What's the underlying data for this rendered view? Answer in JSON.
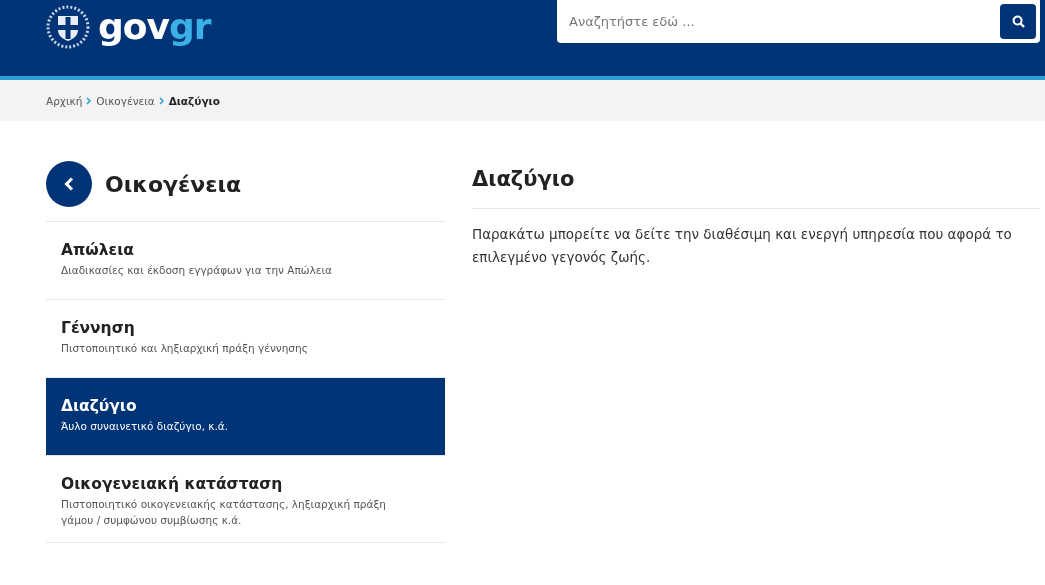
{
  "header": {
    "logo": {
      "main": "gov",
      "accent": "gr"
    },
    "search": {
      "placeholder": "Αναζητήστε εδώ ..."
    }
  },
  "breadcrumb": [
    {
      "label": "Αρχική",
      "current": false
    },
    {
      "label": "Οικογένεια",
      "current": false
    },
    {
      "label": "Διαζύγιο",
      "current": true
    }
  ],
  "sidebar": {
    "title": "Οικογένεια",
    "items": [
      {
        "title": "Απώλεια",
        "description": "Διαδικασίες και έκδοση εγγράφων για την Απώλεια",
        "selected": false
      },
      {
        "title": "Γέννηση",
        "description": "Πιστοποιητικό και ληξιαρχική πράξη γέννησης",
        "selected": false
      },
      {
        "title": "Διαζύγιο",
        "description": "Άυλο συναινετικό διαζύγιο, κ.ά.",
        "selected": true
      },
      {
        "title": "Οικογενειακή κατάσταση",
        "description": "Πιστοποιητικό οικογενειακής κατάστασης, ληξιαρχική πράξη γάμου / συμφώνου συμβίωσης κ.ά.",
        "selected": false
      }
    ]
  },
  "main": {
    "title": "Διαζύγιο",
    "text": "Παρακάτω μπορείτε να δείτε την διαθέσιμη και ενεργή υπηρεσία που αφορά το επιλεγμένο γεγονός ζωής."
  }
}
